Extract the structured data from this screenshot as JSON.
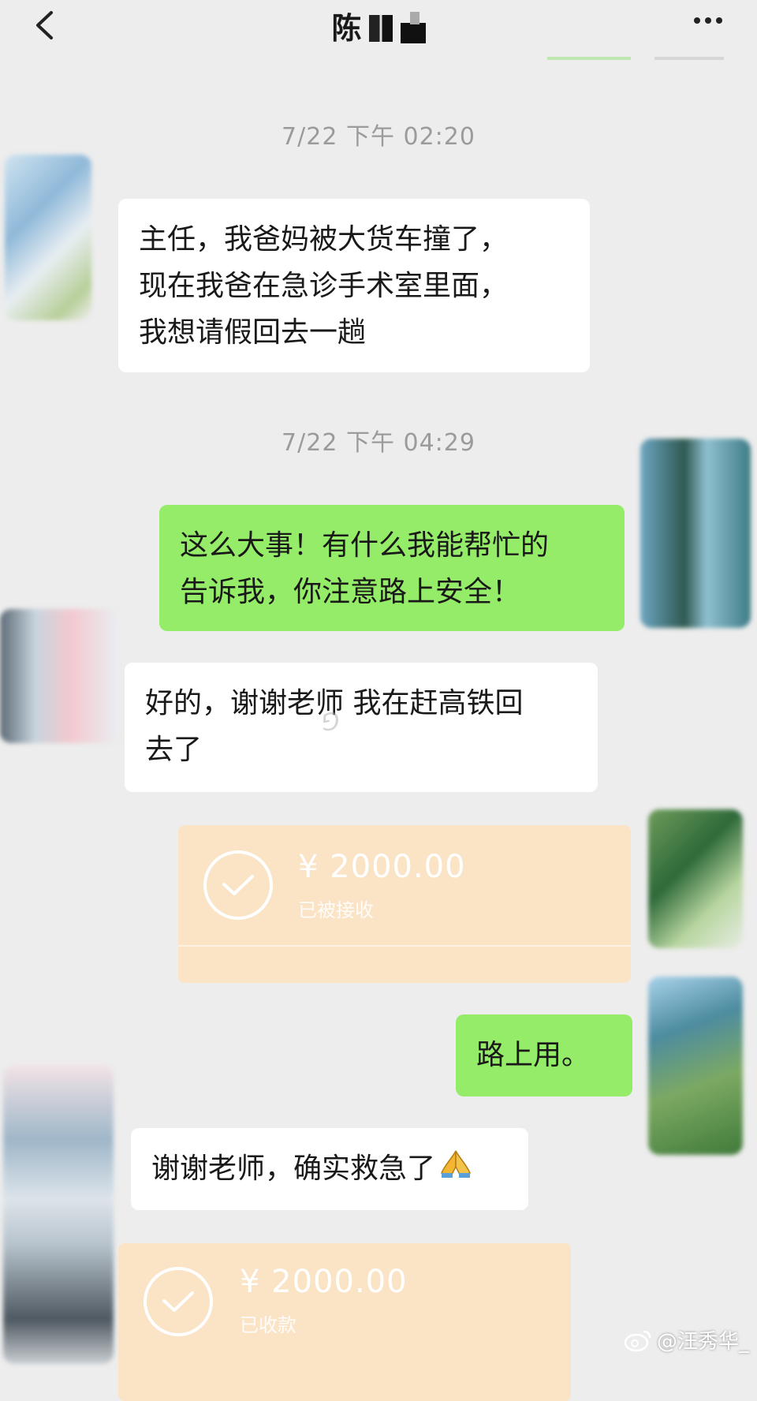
{
  "header": {
    "title": "陈",
    "back_icon": "chevron-left-icon",
    "more_icon": "more-horizontal-icon"
  },
  "messages": {
    "time1": "7/22 下午 02:20",
    "msg1": "主任，我爸妈被大货车撞了，\n现在我爸在急诊手术室里面，\n我想请假回去一趟",
    "time2": "7/22 下午 04:29",
    "msg2": "这么大事！有什么我能帮忙的\n告诉我，你注意路上安全！",
    "msg3": "好的，谢谢老师 我在赶高铁回\n去了",
    "transfer1": {
      "amount": "¥ 2000.00",
      "status": "已被接收",
      "icon": "check-circle-icon"
    },
    "msg4": "路上用。",
    "msg5": "谢谢老师，确实救急了",
    "msg5_emoji": "prayer-hands-icon",
    "transfer2": {
      "amount": "¥ 2000.00",
      "status": "已收款",
      "icon": "check-circle-icon"
    }
  },
  "watermark": {
    "text": "@汪秀华_",
    "icon": "weibo-icon"
  },
  "colors": {
    "background": "#ededed",
    "bubble_left": "#ffffff",
    "bubble_right": "#95ec69",
    "transfer": "#fbe3c6",
    "timestamp": "#9b9b9b"
  }
}
